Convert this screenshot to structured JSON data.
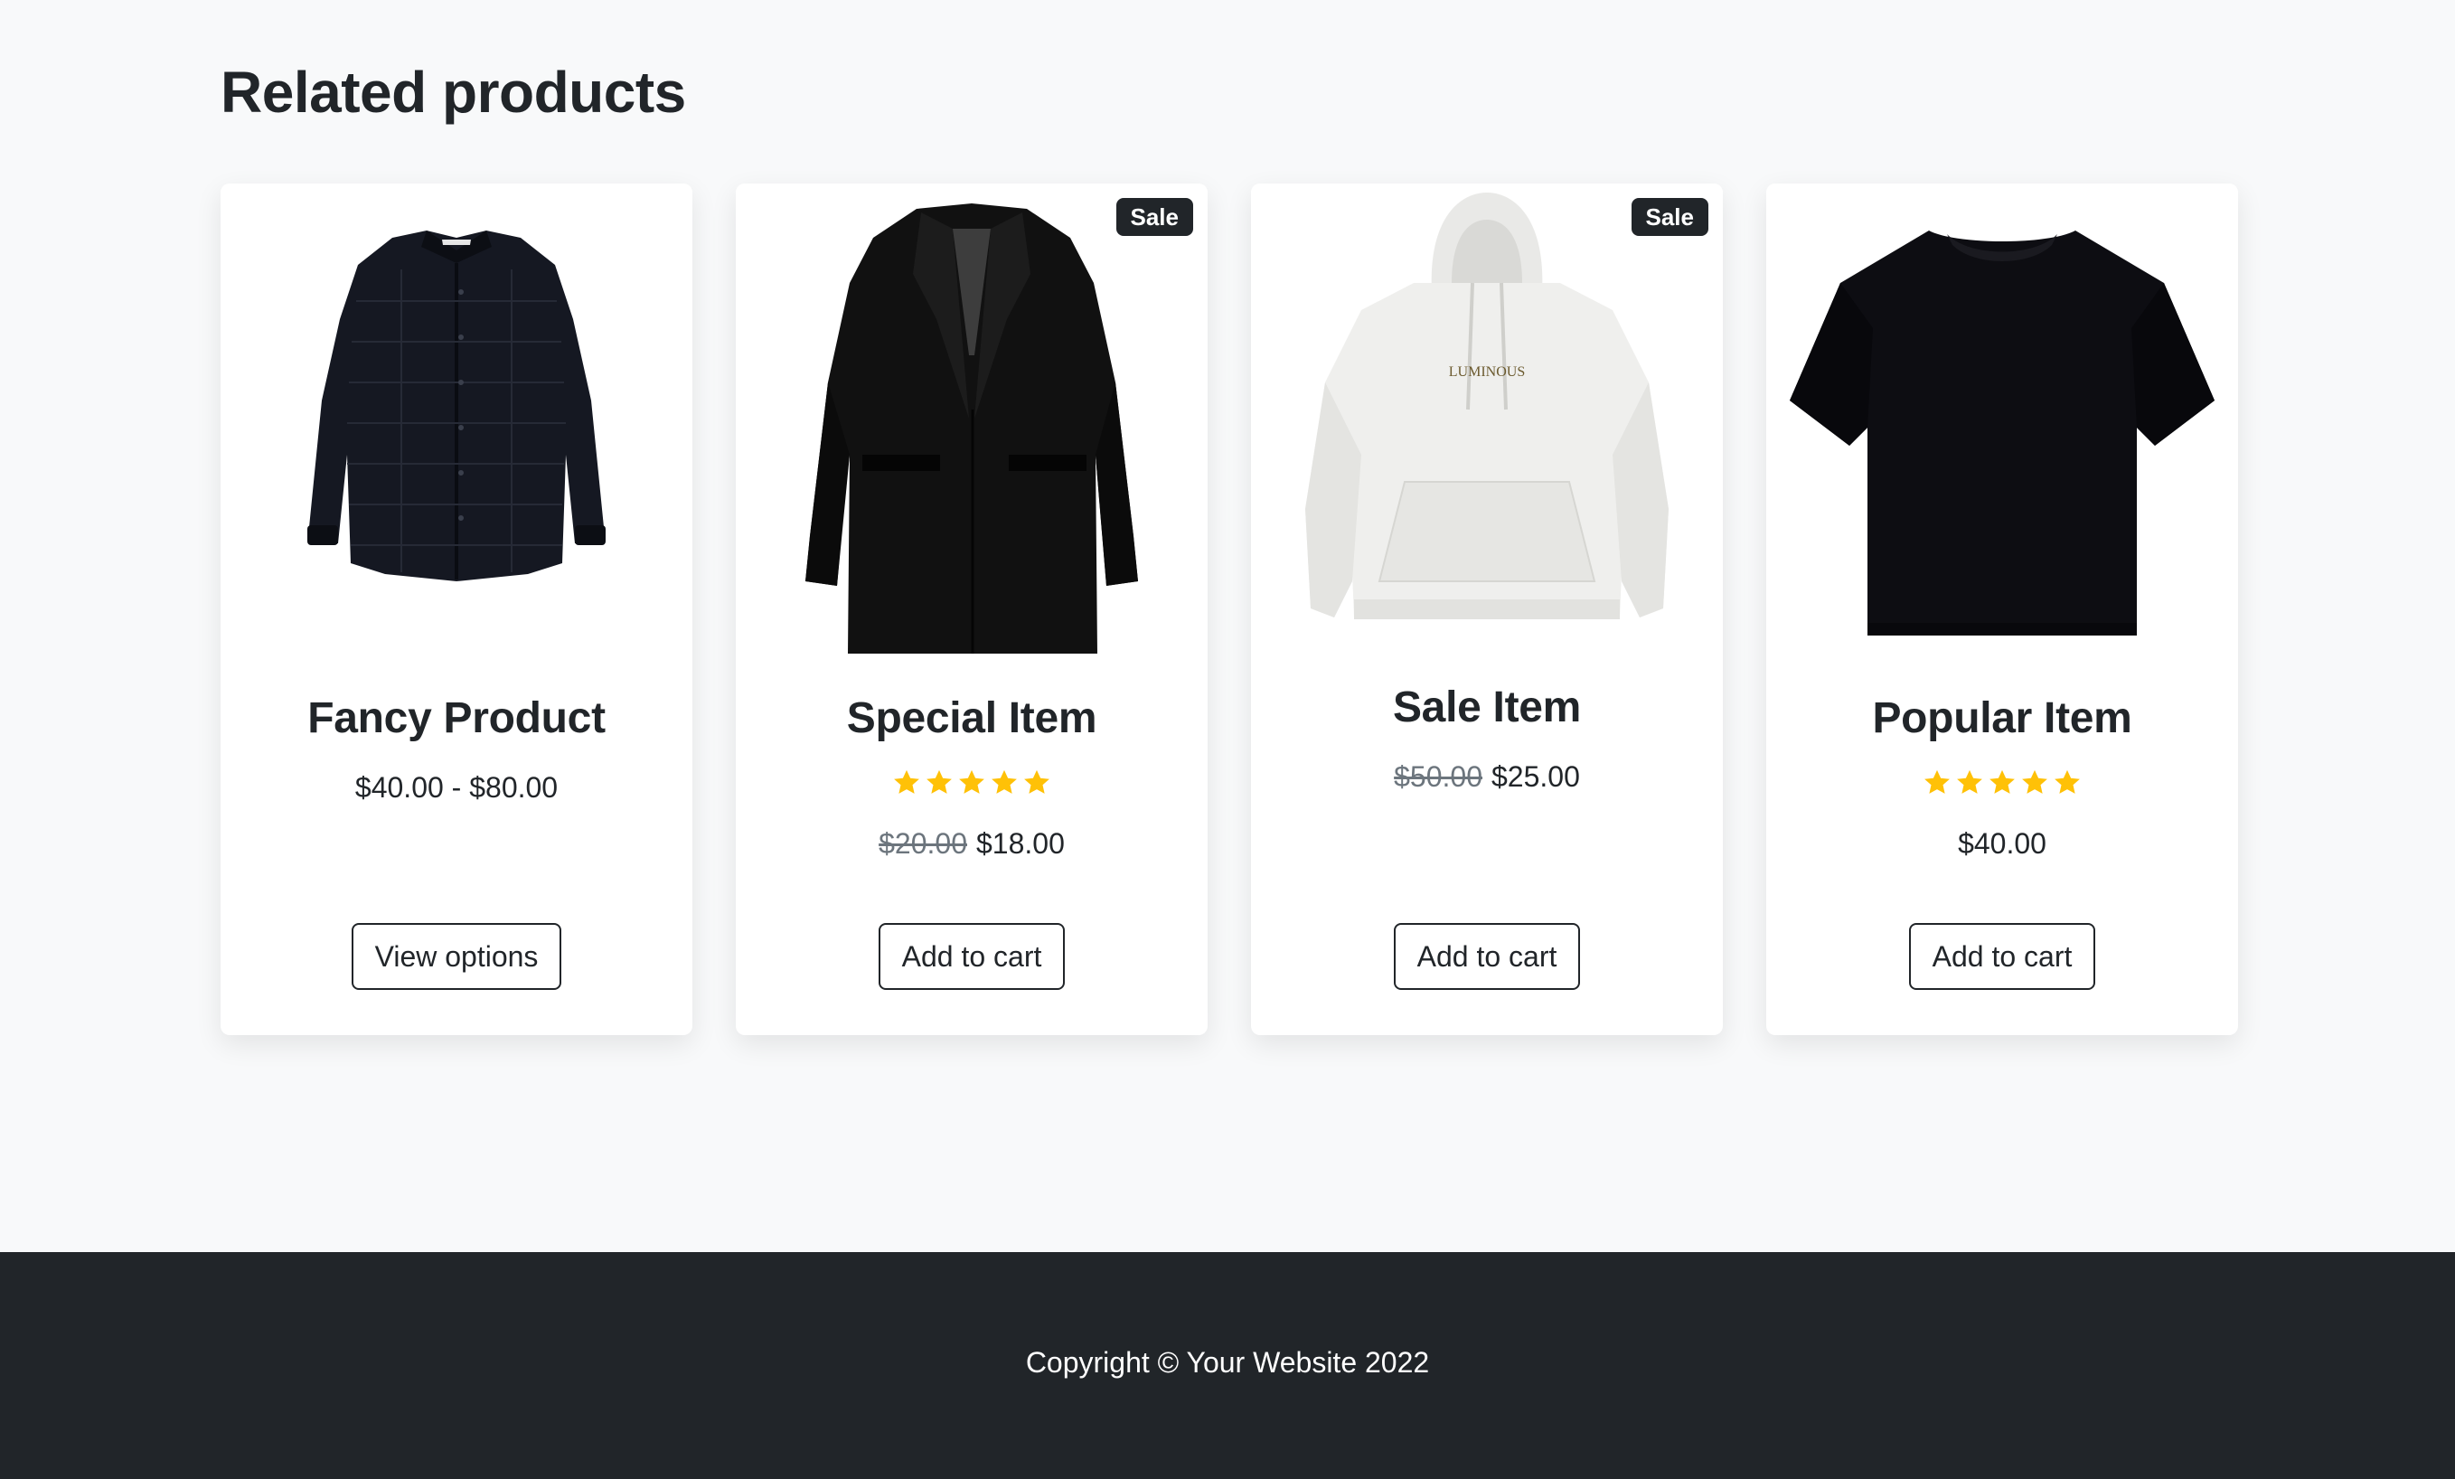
{
  "section": {
    "title": "Related products"
  },
  "products": [
    {
      "name": "Fancy Product",
      "image_icon": "black-quilted-shirt-image",
      "sale_badge": null,
      "rating": null,
      "price": "$40.00 - $80.00",
      "old_price": null,
      "button_label": "View options"
    },
    {
      "name": "Special Item",
      "image_icon": "black-overcoat-image",
      "sale_badge": "Sale",
      "rating": 5,
      "price": "$18.00",
      "old_price": "$20.00",
      "button_label": "Add to cart"
    },
    {
      "name": "Sale Item",
      "image_icon": "white-hoodie-image",
      "sale_badge": "Sale",
      "rating": null,
      "price": "$25.00",
      "old_price": "$50.00",
      "button_label": "Add to cart"
    },
    {
      "name": "Popular Item",
      "image_icon": "black-tshirt-image",
      "sale_badge": null,
      "rating": 5,
      "price": "$40.00",
      "old_price": null,
      "button_label": "Add to cart"
    }
  ],
  "hoodie_print": "LUMINOUS",
  "footer": {
    "copyright": "Copyright © Your Website 2022"
  },
  "colors": {
    "background": "#f8f9fa",
    "footer": "#212529",
    "star": "#ffc107",
    "text": "#212529",
    "muted": "#6c757d"
  }
}
